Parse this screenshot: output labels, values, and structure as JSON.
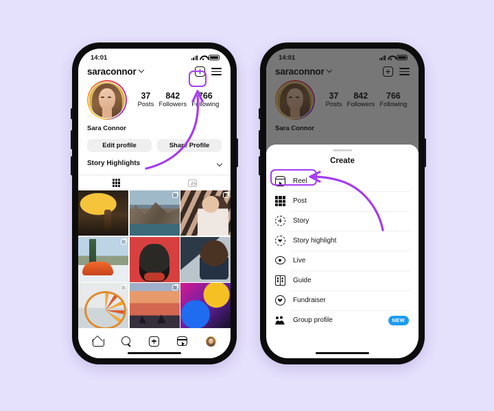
{
  "background_color": "#e5e0fc",
  "accent_color": "#a53cf0",
  "left_phone": {
    "status": {
      "time": "14:01",
      "signal_icon": "cellular-bars-icon",
      "wifi_icon": "wifi-icon",
      "battery_icon": "battery-icon"
    },
    "header": {
      "username": "saraconnor",
      "chevron_icon": "chevron-down-icon",
      "create_icon": "plus-square-icon",
      "menu_icon": "hamburger-menu-icon"
    },
    "profile": {
      "avatar_name": "profile-avatar",
      "full_name": "Sara Connor",
      "stats": [
        {
          "value": "37",
          "label": "Posts"
        },
        {
          "value": "842",
          "label": "Followers"
        },
        {
          "value": "766",
          "label": "Following"
        }
      ]
    },
    "actions": {
      "edit_profile": "Edit profile",
      "share_profile": "Share Profile"
    },
    "highlights": {
      "title": "Story Highlights",
      "chevron_icon": "chevron-down-icon"
    },
    "tabs": [
      {
        "name": "grid-tab",
        "icon": "grid-icon",
        "active": true
      },
      {
        "name": "tagged-tab",
        "icon": "tagged-person-icon",
        "active": false
      }
    ],
    "photos": [
      {
        "name": "photo-umbrella",
        "class": "img-umbrella",
        "badge": "none"
      },
      {
        "name": "photo-mountain-lake",
        "class": "img-mountain",
        "badge": "multi"
      },
      {
        "name": "photo-woman-stripes",
        "class": "img-girl1",
        "badge": "multi"
      },
      {
        "name": "photo-orange-car",
        "class": "img-car",
        "badge": "multi"
      },
      {
        "name": "photo-black-dog",
        "class": "img-dog",
        "badge": "none"
      },
      {
        "name": "photo-curly-hair-woman",
        "class": "img-curly",
        "badge": "none"
      },
      {
        "name": "photo-ferris-wheel",
        "class": "img-wheel",
        "badge": "multi"
      },
      {
        "name": "photo-sunset-cyclists",
        "class": "img-sunset",
        "badge": "multi"
      },
      {
        "name": "photo-neon-concert",
        "class": "img-neon",
        "badge": "none"
      }
    ],
    "bottom_nav": [
      {
        "name": "nav-home",
        "icon": "home-icon"
      },
      {
        "name": "nav-search",
        "icon": "search-icon"
      },
      {
        "name": "nav-create",
        "icon": "plus-square-icon"
      },
      {
        "name": "nav-reels",
        "icon": "reels-icon"
      },
      {
        "name": "nav-profile",
        "icon": "avatar-icon"
      }
    ]
  },
  "right_phone": {
    "status": {
      "time": "14:01",
      "signal_icon": "cellular-bars-icon",
      "wifi_icon": "wifi-icon",
      "battery_icon": "battery-icon"
    },
    "header": {
      "username": "saraconnor",
      "chevron_icon": "chevron-down-icon",
      "create_icon": "plus-square-icon",
      "menu_icon": "hamburger-menu-icon"
    },
    "profile": {
      "full_name": "Sara Connor",
      "stats": [
        {
          "value": "37",
          "label": "Posts"
        },
        {
          "value": "842",
          "label": "Followers"
        },
        {
          "value": "766",
          "label": "Following"
        }
      ]
    },
    "sheet": {
      "grabber": "sheet-grabber",
      "title": "Create",
      "items": [
        {
          "name": "create-reel",
          "label": "Reel",
          "icon": "reel-icon",
          "iconClass": "ico-reel",
          "highlighted": true,
          "badge": ""
        },
        {
          "name": "create-post",
          "label": "Post",
          "icon": "grid-post-icon",
          "iconClass": "ico-post",
          "highlighted": false,
          "badge": ""
        },
        {
          "name": "create-story",
          "label": "Story",
          "icon": "story-plus-icon",
          "iconClass": "ico-story",
          "highlighted": false,
          "badge": ""
        },
        {
          "name": "create-story-highlight",
          "label": "Story highlight",
          "icon": "story-highlight-icon",
          "iconClass": "ico-hl",
          "highlighted": false,
          "badge": ""
        },
        {
          "name": "create-live",
          "label": "Live",
          "icon": "live-broadcast-icon",
          "iconClass": "ico-live",
          "highlighted": false,
          "badge": ""
        },
        {
          "name": "create-guide",
          "label": "Guide",
          "icon": "guide-book-icon",
          "iconClass": "ico-guide",
          "highlighted": false,
          "badge": ""
        },
        {
          "name": "create-fundraiser",
          "label": "Fundraiser",
          "icon": "fundraiser-heart-icon",
          "iconClass": "ico-fund",
          "highlighted": false,
          "badge": ""
        },
        {
          "name": "create-group-profile",
          "label": "Group profile",
          "icon": "group-people-icon",
          "iconClass": "ico-group",
          "highlighted": false,
          "badge": "NEW"
        }
      ]
    }
  },
  "annotations": {
    "left_arrow": {
      "name": "arrow-to-create-button",
      "color": "#a53cf0"
    },
    "right_arrow": {
      "name": "arrow-to-reel-item",
      "color": "#a53cf0"
    },
    "left_highlight": {
      "name": "highlight-create-button",
      "color": "#a53cf0"
    },
    "right_highlight": {
      "name": "highlight-reel-item",
      "color": "#a53cf0"
    }
  }
}
